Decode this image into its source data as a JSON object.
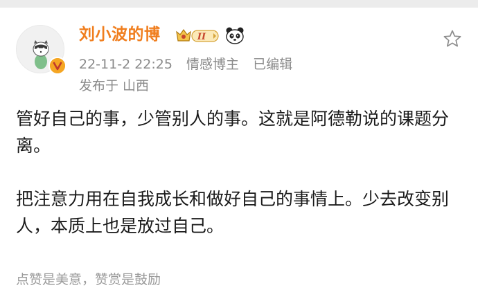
{
  "post": {
    "author": {
      "name": "刘小波的博",
      "vip_level": "II"
    },
    "timestamp": "22-11-2 22:25",
    "user_tag": "情感博主",
    "edited_label": "已编辑",
    "location_prefix": "发布于",
    "location": "山西",
    "paragraphs": [
      "管好自己的事，少管别人的事。这就是阿德勒说的课题分离。",
      "把注意力用在自我成长和做好自己的事情上。少去改变别人，本质上也是放过自己。"
    ],
    "reward_hint": "点赞是美意，赞赏是鼓励"
  },
  "icons": {
    "favorite": "star-outline-icon",
    "verified": "verified-badge-icon",
    "vip": "crown-vip-badge-icon",
    "panda": "panda-badge-icon"
  },
  "colors": {
    "username": "#f07e1e",
    "meta_text": "#8a8a8a",
    "body_text": "#1a1a1a",
    "verified_badge": "#f5a623"
  }
}
